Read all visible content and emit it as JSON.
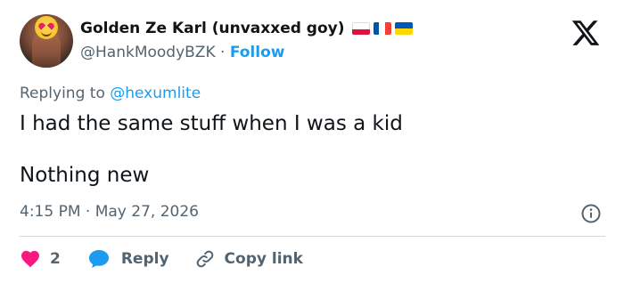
{
  "author": {
    "display_name": "Golden Ze Karl (unvaxxed goy)",
    "handle": "@HankMoodyBZK",
    "follow_label": "Follow",
    "separator": "·",
    "flags": [
      "poland-flag",
      "france-flag",
      "ukraine-flag"
    ]
  },
  "reply": {
    "prefix": "Replying to ",
    "mention": "@hexumlite"
  },
  "tweet": {
    "line1": "I had the same stuff when I was a kid",
    "line2": "Nothing new"
  },
  "meta": {
    "timestamp": "4:15 PM · May 27, 2026"
  },
  "actions": {
    "like_count": "2",
    "reply_label": "Reply",
    "copy_label": "Copy link"
  },
  "colors": {
    "accent": "#1d9bf0",
    "like": "#f91880",
    "text": "#0f1419",
    "muted": "#536471",
    "divider": "#cfd9de"
  },
  "icons": {
    "logo": "x-logo-icon",
    "info": "info-icon",
    "like": "heart-icon",
    "reply": "speech-bubble-icon",
    "copy": "link-icon"
  }
}
